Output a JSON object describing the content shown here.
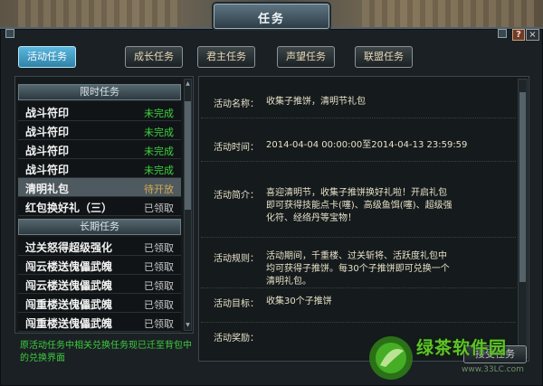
{
  "window": {
    "title": "任务",
    "help_label": "?",
    "close_label": "×"
  },
  "tabs": [
    {
      "label": "活动任务",
      "active": true
    },
    {
      "label": "成长任务",
      "active": false
    },
    {
      "label": "君主任务",
      "active": false
    },
    {
      "label": "声望任务",
      "active": false
    },
    {
      "label": "联盟任务",
      "active": false
    }
  ],
  "limited_section": {
    "title": "限时任务",
    "items": [
      {
        "name": "战斗符印",
        "status": "未完成",
        "selected": false
      },
      {
        "name": "战斗符印",
        "status": "未完成",
        "selected": false
      },
      {
        "name": "战斗符印",
        "status": "未完成",
        "selected": false
      },
      {
        "name": "战斗符印",
        "status": "未完成",
        "selected": false
      },
      {
        "name": "清明礼包",
        "status": "待开放",
        "selected": true
      },
      {
        "name": "红包换好礼（三）",
        "status": "已领取",
        "selected": false
      }
    ]
  },
  "longterm_section": {
    "title": "长期任务",
    "items": [
      {
        "name": "过关怒得超级强化",
        "status": "已领取"
      },
      {
        "name": "闯云楼送傀儡武魄",
        "status": "已领取"
      },
      {
        "name": "闯云楼送傀儡武魄",
        "status": "已领取"
      },
      {
        "name": "闯重楼送傀儡武魄",
        "status": "已领取"
      },
      {
        "name": "闯重楼送傀儡武魄",
        "status": "已领取"
      }
    ]
  },
  "note": "原活动任务中相关兑换任务现已迁至背包中的兑换界面",
  "detail": {
    "name": {
      "label": "活动名称：",
      "value": "收集子推饼，清明节礼包"
    },
    "time": {
      "label": "活动时间：",
      "value": "2014-04-04 00:00:00至2014-04-13 23:59:59"
    },
    "intro": {
      "label": "活动简介：",
      "value": "喜迎清明节，收集子推饼换好礼啦！开启礼包即可获得技能点卡(噻)、高级鱼饵(噻)、超级强化符、经络丹等宝物！"
    },
    "rules": {
      "label": "活动规则：",
      "value": "活动期间，千重楼、过关斩将、活跃度礼包中均可获得子推饼。每30个子推饼即可兑换一个清明礼包。"
    },
    "target": {
      "label": "活动目标：",
      "value": "收集30个子推饼"
    },
    "reward": {
      "label": "活动奖励：",
      "value": ""
    }
  },
  "accept_button": "接受任务",
  "watermark": {
    "text": "绿茶软件园",
    "url": "www.33LC.com"
  },
  "colors": {
    "status_incomplete": "#3ed23e",
    "status_pending": "#d9a850",
    "status_claimed": "#c9c9c9",
    "active_tab": "#3c9ac2",
    "note_text": "#3fcc3f"
  }
}
